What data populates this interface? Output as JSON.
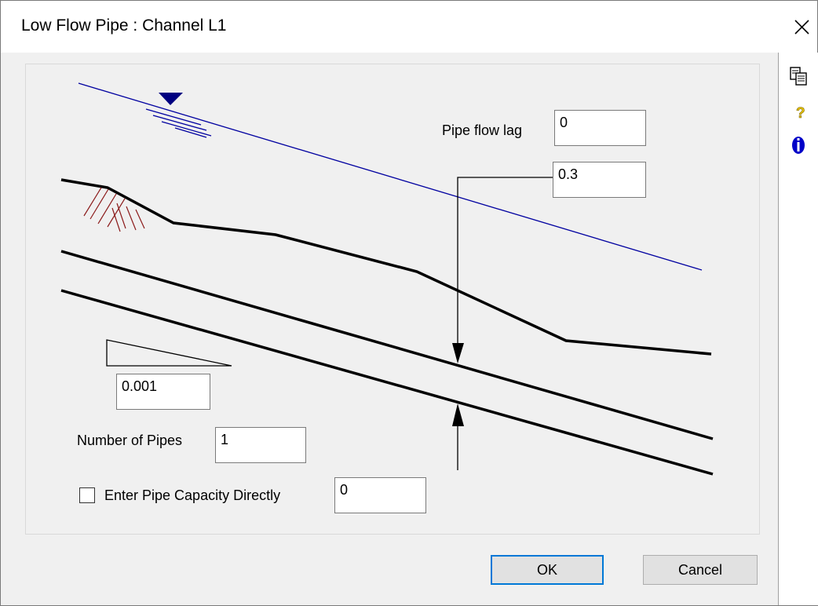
{
  "window": {
    "title": "Low Flow Pipe : Channel L1"
  },
  "toolbar_icons": [
    "copy-icon",
    "help-icon",
    "info-icon"
  ],
  "form": {
    "pipe_flow_lag_label": "Pipe flow lag",
    "pipe_flow_lag_value": "0",
    "pipe_diameter_value": "0.3",
    "slope_value": "0.001",
    "number_of_pipes_label": "Number of Pipes",
    "number_of_pipes_value": "1",
    "enter_capacity_label": "Enter Pipe Capacity Directly",
    "enter_capacity_checked": false,
    "pipe_capacity_value": "0"
  },
  "buttons": {
    "ok": "OK",
    "cancel": "Cancel"
  },
  "colors": {
    "water_line": "#0000a0",
    "ground_hatch": "#8b1a1a",
    "default_button_border": "#0078d7"
  }
}
